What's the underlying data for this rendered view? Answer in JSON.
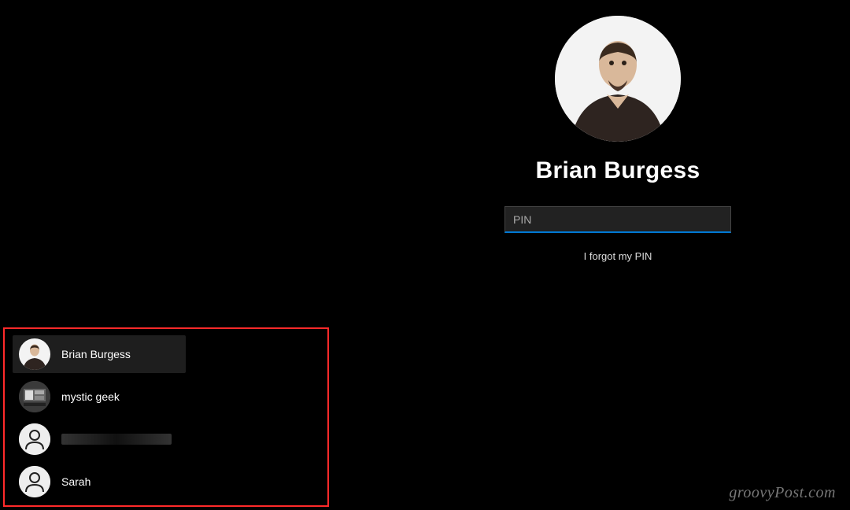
{
  "login": {
    "selected_user": "Brian Burgess",
    "pin_placeholder": "PIN",
    "forgot_label": "I forgot my PIN"
  },
  "users": [
    {
      "name": "Brian Burgess",
      "avatar_type": "photo1",
      "selected": true
    },
    {
      "name": "mystic geek",
      "avatar_type": "photo2",
      "selected": false
    },
    {
      "name": "",
      "avatar_type": "generic",
      "selected": false,
      "redacted": true
    },
    {
      "name": "Sarah",
      "avatar_type": "generic",
      "selected": false
    }
  ],
  "watermark": "groovyPost.com",
  "colors": {
    "accent": "#0078d4",
    "highlight_border": "#ff2a2a",
    "background": "#000000"
  }
}
